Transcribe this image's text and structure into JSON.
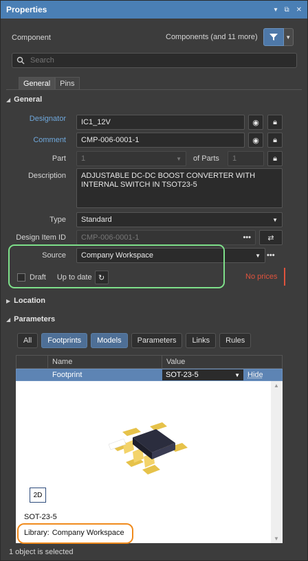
{
  "title": "Properties",
  "title_icons": [
    "pin-icon",
    "maximize-icon",
    "close-icon"
  ],
  "header": {
    "left_label": "Component",
    "filter_label": "Components (and 11 more)"
  },
  "search": {
    "placeholder": "Search"
  },
  "tabs": [
    {
      "label": "General",
      "active": true
    },
    {
      "label": "Pins",
      "active": false
    }
  ],
  "general": {
    "header": "General",
    "designator_label": "Designator",
    "designator_value": "IC1_12V",
    "comment_label": "Comment",
    "comment_value": "CMP-006-0001-1",
    "part_label": "Part",
    "part_value": "1",
    "of_parts_label": "of Parts",
    "of_parts_value": "1",
    "description_label": "Description",
    "description_value": "ADJUSTABLE DC-DC BOOST CONVERTER WITH INTERNAL SWITCH IN  TSOT23-5",
    "type_label": "Type",
    "type_value": "Standard",
    "design_item_label": "Design Item ID",
    "design_item_value": "CMP-006-0001-1",
    "source_label": "Source",
    "source_value": "Company Workspace",
    "draft_label": "Draft",
    "uptodate_label": "Up to date",
    "no_prices": "No prices"
  },
  "location": {
    "header": "Location"
  },
  "parameters": {
    "header": "Parameters",
    "buttons": [
      {
        "label": "All",
        "on": false
      },
      {
        "label": "Footprints",
        "on": true
      },
      {
        "label": "Models",
        "on": true
      },
      {
        "label": "Parameters",
        "on": false
      },
      {
        "label": "Links",
        "on": false
      },
      {
        "label": "Rules",
        "on": false
      }
    ],
    "col_name": "Name",
    "col_value": "Value",
    "row": {
      "name": "Footprint",
      "value": "SOT-23-5",
      "action": "Hide"
    },
    "view_mode": "2D",
    "footprint_name": "SOT-23-5",
    "library_label": "Library:",
    "library_value": "Company Workspace"
  },
  "status": "1 object is selected",
  "colors": {
    "titlebar": "#4a7fb5",
    "link": "#6fa8dc",
    "highlight_green": "#7ee08a",
    "highlight_orange": "#f08a1c",
    "no_prices": "#e0533d"
  }
}
